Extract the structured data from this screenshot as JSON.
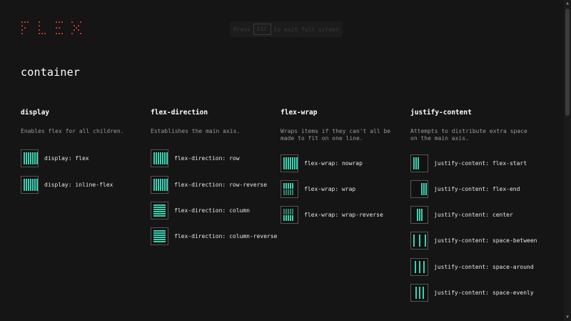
{
  "header": {
    "logo_text": "FLEX",
    "esc_hint": {
      "before": "Press",
      "key": "ESC",
      "after": "to exit full screen"
    }
  },
  "section": {
    "title": "container"
  },
  "colors": {
    "accent": "#3ecfb0",
    "background": "#151515",
    "text": "#e6e6e6",
    "muted": "#9a9a9a"
  },
  "columns": [
    {
      "title": "display",
      "description": "Enables flex for all children.",
      "items": [
        {
          "label": "display: flex",
          "icon": "flex-row-icon"
        },
        {
          "label": "display: inline-flex",
          "icon": "flex-row-icon"
        }
      ]
    },
    {
      "title": "flex-direction",
      "description": "Establishes the main axis.",
      "items": [
        {
          "label": "flex-direction: row",
          "icon": "flex-row-icon"
        },
        {
          "label": "flex-direction: row-reverse",
          "icon": "flex-row-icon"
        },
        {
          "label": "flex-direction: column",
          "icon": "flex-column-icon"
        },
        {
          "label": "flex-direction: column-reverse",
          "icon": "flex-column-icon"
        }
      ]
    },
    {
      "title": "flex-wrap",
      "description": "Wraps items if they can't all be made to fit on one line.",
      "items": [
        {
          "label": "flex-wrap: nowrap",
          "icon": "nowrap-icon"
        },
        {
          "label": "flex-wrap: wrap",
          "icon": "wrap-icon"
        },
        {
          "label": "flex-wrap: wrap-reverse",
          "icon": "wrap-reverse-icon"
        }
      ]
    },
    {
      "title": "justify-content",
      "description": "Attempts to distribute extra space on the main axis.",
      "items": [
        {
          "label": "justify-content: flex-start",
          "icon": "justify-start-icon"
        },
        {
          "label": "justify-content: flex-end",
          "icon": "justify-end-icon"
        },
        {
          "label": "justify-content: center",
          "icon": "justify-center-icon"
        },
        {
          "label": "justify-content: space-between",
          "icon": "justify-between-icon"
        },
        {
          "label": "justify-content: space-around",
          "icon": "justify-around-icon"
        },
        {
          "label": "justify-content: space-evenly",
          "icon": "justify-evenly-icon"
        }
      ]
    }
  ]
}
